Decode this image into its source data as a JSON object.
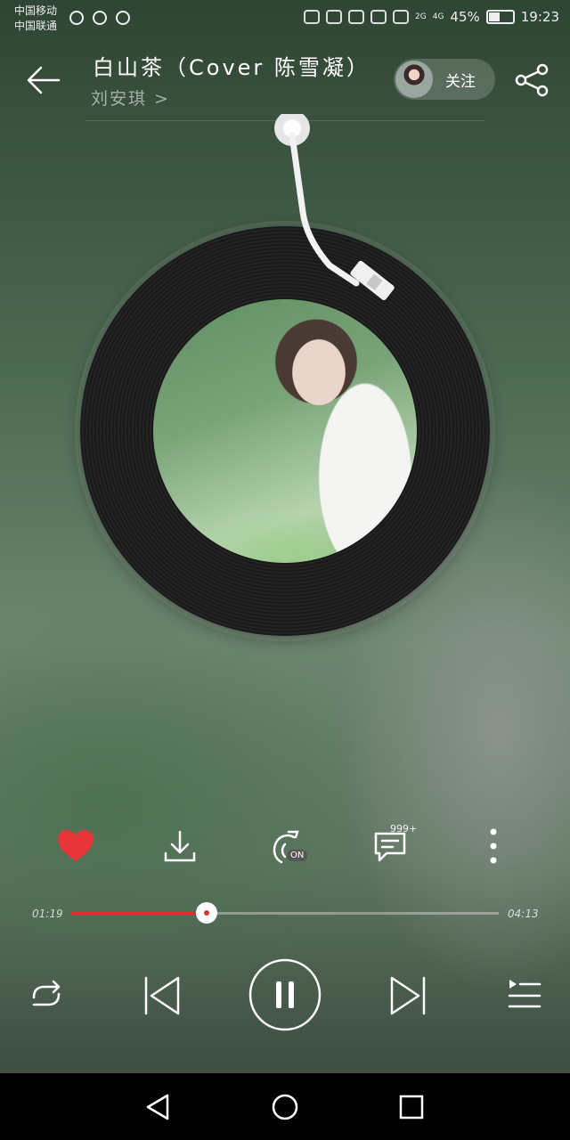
{
  "status_bar": {
    "carrier1": "中国移动",
    "carrier2": "中国联通",
    "network1": "2G",
    "network2": "4G",
    "battery": "45%",
    "time": "19:23"
  },
  "header": {
    "title": "白山茶（Cover 陈雪凝）",
    "artist": "刘安琪 >",
    "follow_label": "关注"
  },
  "actions": {
    "sound_effect_badge": "ON",
    "comment_count": "999+"
  },
  "progress": {
    "elapsed": "01:19",
    "total": "04:13",
    "fraction": 0.316
  },
  "colors": {
    "accent": "#d9342b",
    "heart": "#e8353a"
  }
}
